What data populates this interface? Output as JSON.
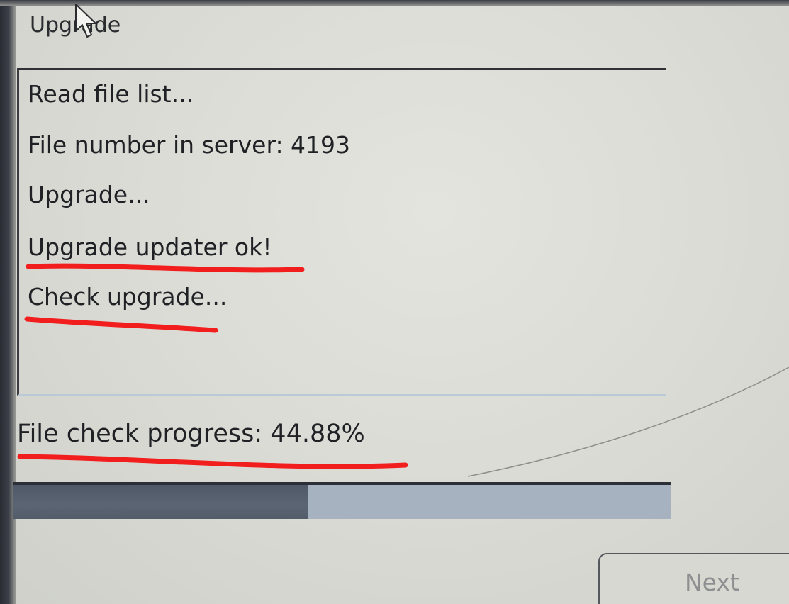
{
  "window": {
    "title": "Upgrade"
  },
  "log": {
    "lines": [
      "Read file list...",
      "File number in server: 4193",
      "Upgrade...",
      "Upgrade updater ok!",
      "Check upgrade..."
    ]
  },
  "progress": {
    "label": "File check progress: 44.88%",
    "value": 0.4488
  },
  "buttons": {
    "next": "Next"
  },
  "colors": {
    "annotation_red": "#f21d1d",
    "progress_fill": "#555f6d",
    "progress_track": "#a7b2c0"
  },
  "icons": {
    "cursor": "mouse-pointer-icon"
  }
}
